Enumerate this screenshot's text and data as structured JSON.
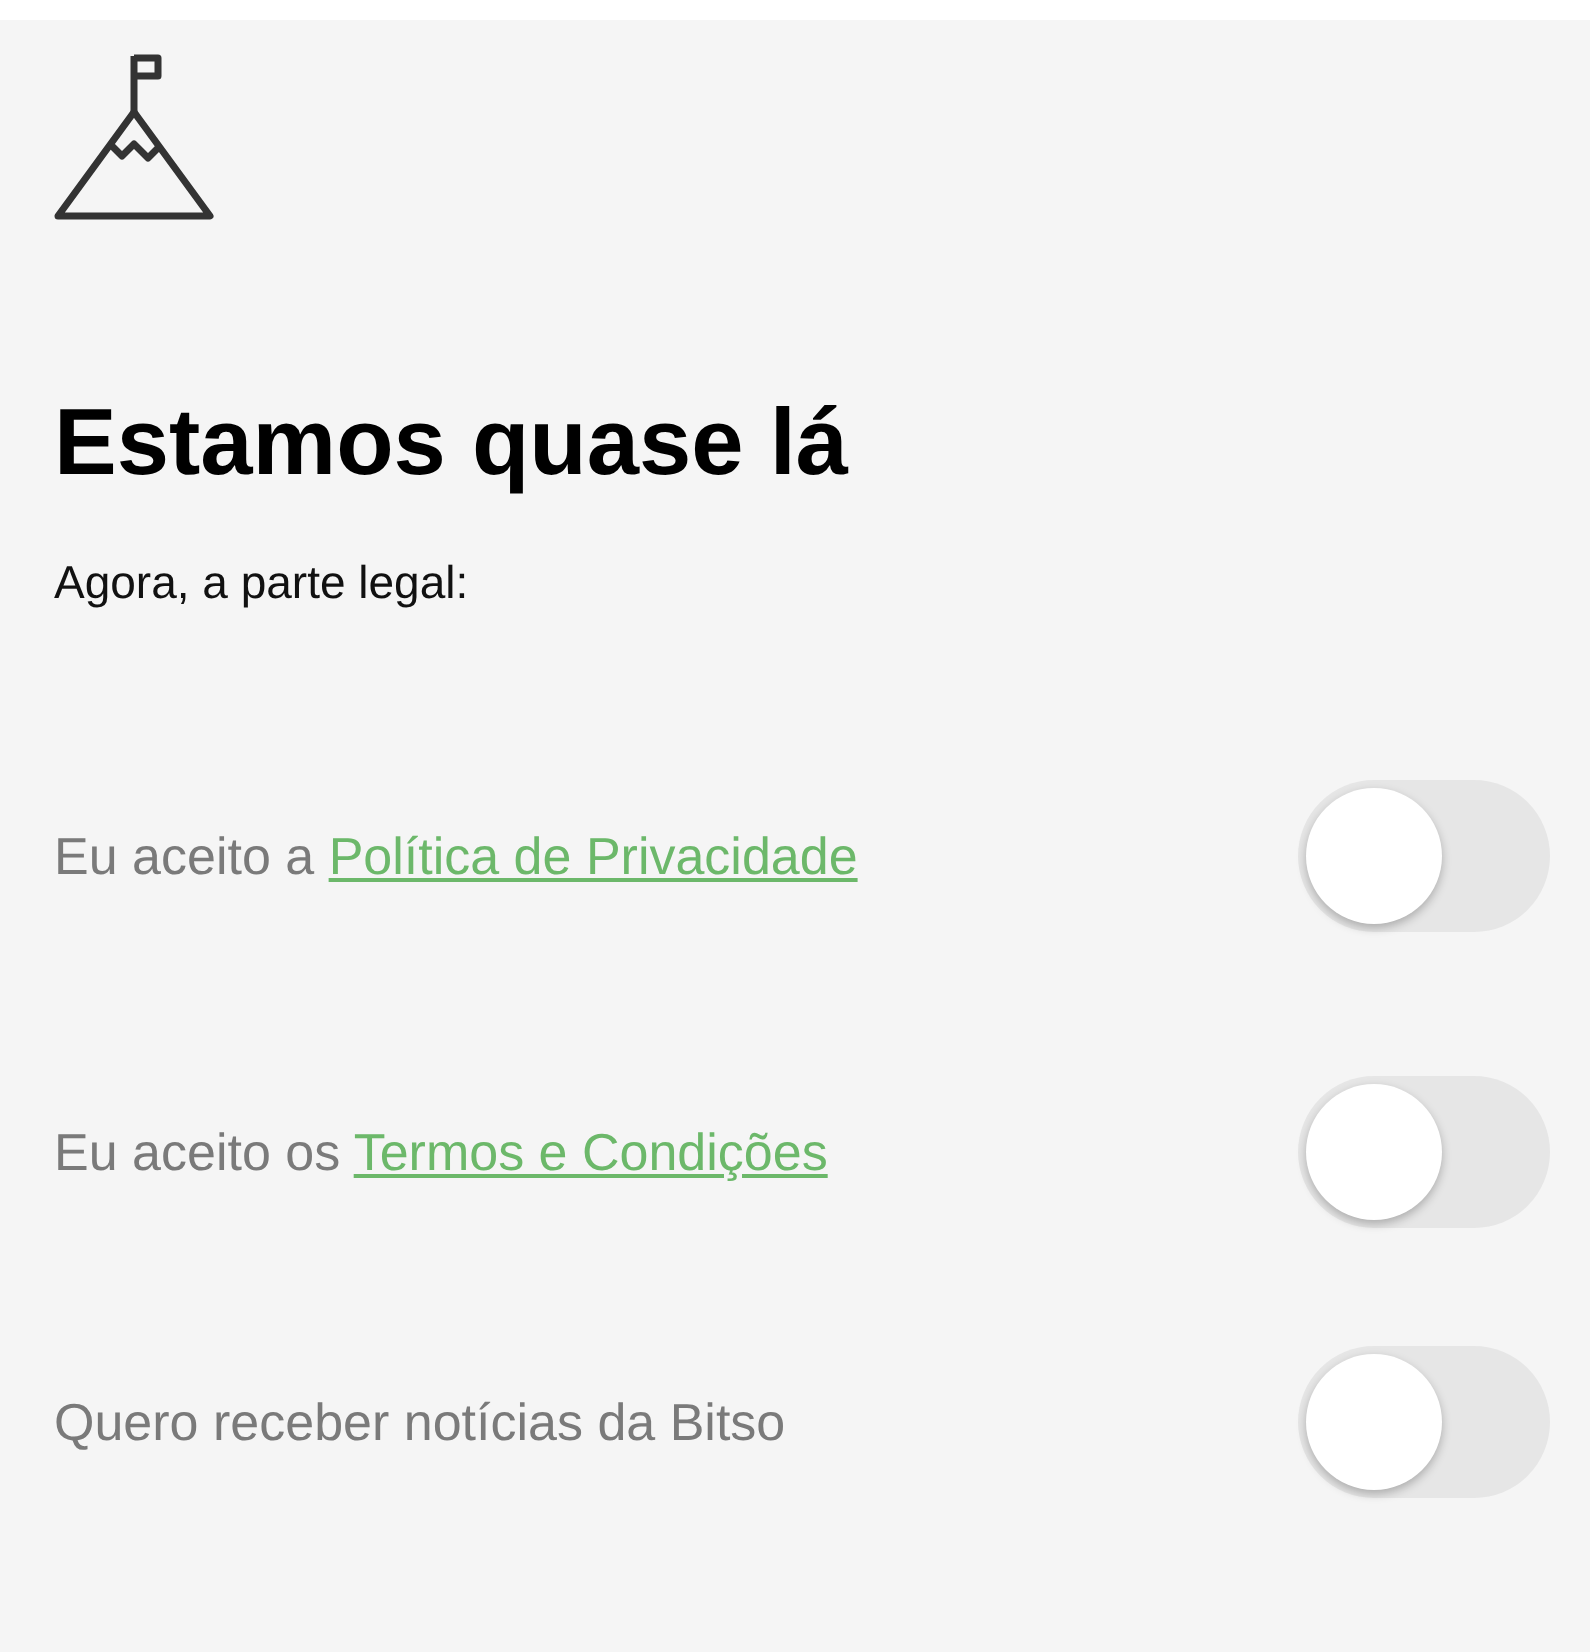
{
  "title": "Estamos quase lá",
  "subtitle": "Agora, a parte legal:",
  "options": [
    {
      "text": "Eu aceito a ",
      "link": "Política de Privacidade",
      "on": false
    },
    {
      "text": "Eu aceito os ",
      "link": "Termos e Condições",
      "on": false
    },
    {
      "text": "Quero receber notícias da Bitso",
      "on": false
    }
  ]
}
